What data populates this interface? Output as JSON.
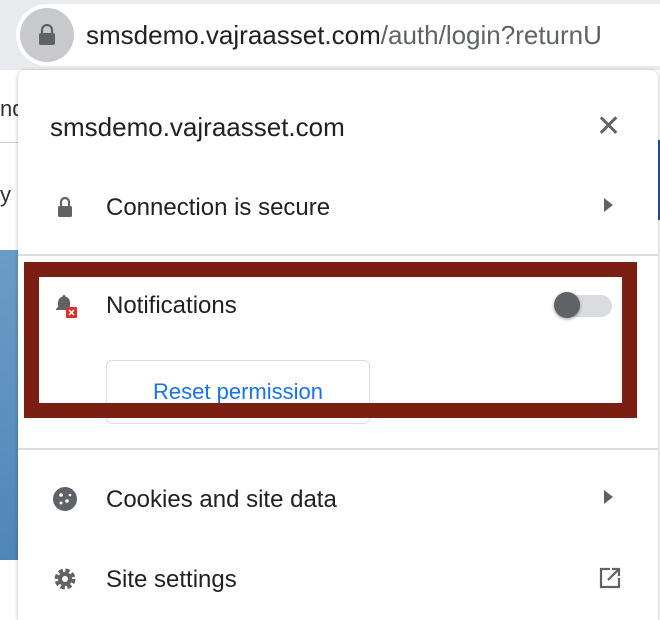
{
  "address_bar": {
    "url_host": "smsdemo.vajraasset.com",
    "url_rest": "/auth/login?returnU"
  },
  "background_page": {
    "text_fragment_1": "nd",
    "text_fragment_2": "y"
  },
  "popup": {
    "title": "smsdemo.vajraasset.com",
    "close_icon": "close-icon",
    "connection": {
      "label": "Connection is secure",
      "icon": "lock-icon"
    },
    "notifications": {
      "label": "Notifications",
      "icon": "bell-blocked-icon",
      "toggle_on": false,
      "reset_label": "Reset permission"
    },
    "cookies": {
      "label": "Cookies and site data",
      "icon": "cookie-icon"
    },
    "site_settings": {
      "label": "Site settings",
      "icon": "gear-icon",
      "trailing_icon": "open-external-icon"
    }
  },
  "colors": {
    "highlight": "#7a1f12",
    "link": "#1a73e8"
  }
}
